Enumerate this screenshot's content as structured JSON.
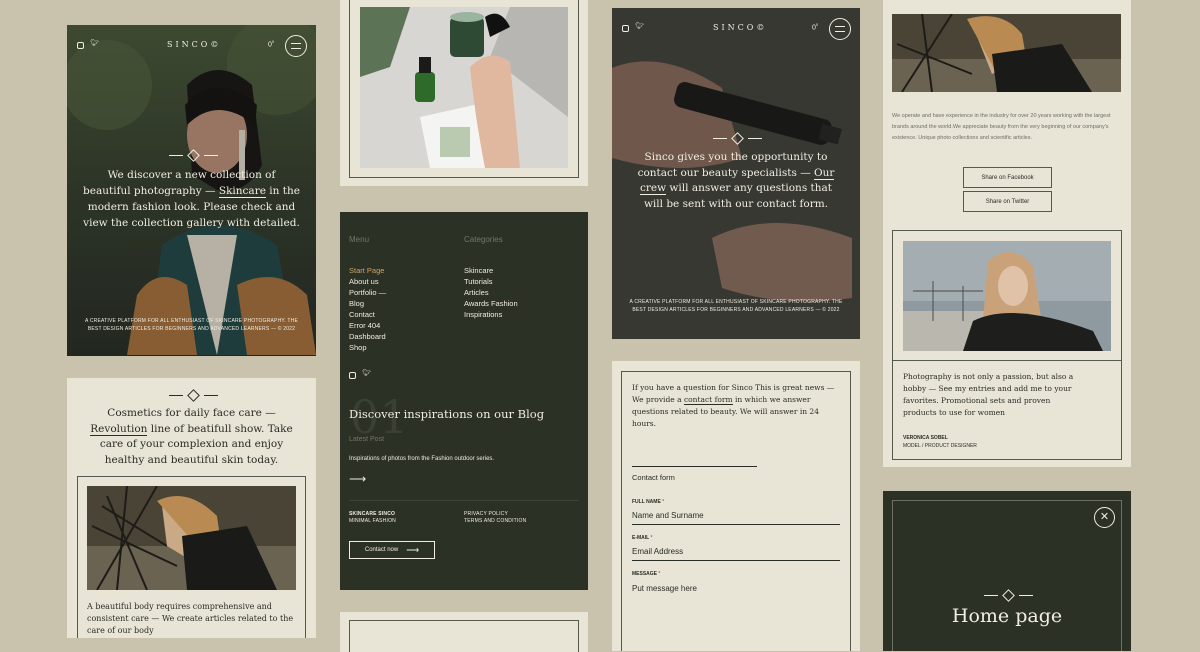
{
  "brand": "SINCO©",
  "hero_phone": {
    "counter": "0",
    "counter_sup": "0",
    "text_a": "We discover a new collection of beautiful photography — ",
    "text_link": "Skincare",
    "text_b": " in the modern fashion look. Please check and view the collection gallery with detailed.",
    "footer": "A CREATIVE PLATFORM FOR ALL ENTHUSIAST OF SKINCARE PHOTOGRAPHY. THE BEST DESIGN ARTICLES FOR BEGINNERS AND ADVANCED LEARNERS — © 2022"
  },
  "cosmetics": {
    "text_a": "Cosmetics for daily face care — ",
    "text_link": "Revolution",
    "text_b": " line of beatifull show. Take care of your complexion and enjoy healthy and beautiful skin today.",
    "body": "A beautiful body requires comprehensive and consistent care — We create articles related to the care of our body"
  },
  "menu": {
    "menu_title": "Menu",
    "categories_title": "Categories",
    "items": [
      "Start Page",
      "About us",
      "Portfolio —",
      "Blog",
      "Contact",
      "Error 404",
      "Dashboard",
      "Shop"
    ],
    "categories": [
      "Skincare",
      "Tutorials",
      "Articles",
      "Awards Fashion",
      "Inspirations"
    ],
    "blog_title": "Discover inspirations on our Blog",
    "big_number": "01",
    "latest_label": "Latest Post",
    "latest_text": "Inspirations of photos from the Fashion outdoor series.",
    "footer_left": [
      "SKINCARE SINCO",
      "MINIMAL FASHION"
    ],
    "footer_right": [
      "PRIVACY POLICY",
      "TERMS AND CONDITION"
    ],
    "contact_button": "Contact now",
    "accent": "#c9a66b"
  },
  "specialists_phone": {
    "counter": "0",
    "counter_sup": "0",
    "text_a": "Sinco gives you the opportunity to contact our beauty specialists — ",
    "text_link": "Our crew",
    "text_b": " will answer any questions that will be sent with our contact form.",
    "footer": "A CREATIVE PLATFORM FOR ALL ENTHUSIAST OF SKINCARE PHOTOGRAPHY. THE BEST DESIGN ARTICLES FOR BEGINNERS AND ADVANCED LEARNERS — © 2022"
  },
  "contact": {
    "intro_a": "If you have a question for Sinco This is great news — We provide a ",
    "intro_link": "contact form",
    "intro_b": " in which we answer questions related to beauty. We will answer in 24 hours.",
    "form_title": "Contact form",
    "name_label": "FULL NAME",
    "name_value": "Name and Surname",
    "email_label": "E-MAIL",
    "email_value": "Email Address",
    "message_label": "MESSAGE",
    "message_value": "Put message here",
    "required_mark": "*"
  },
  "about": {
    "text": "We operate and have experience in the industry for over 20 years working with the largest brands around the world.We appreciate beauty from the very beginning of our company's existence. Unique photo collections and scientific articles.",
    "facebook": "Share on Facebook",
    "twitter": "Share on Twitter",
    "quote": "Photography is not only a passion, but also a hobby — See my entries and add me to your favorites. Promotional sets and proven products to use for women",
    "author": "VERONICA SOBEL",
    "author_role": "MODEL / PRODUCT DESIGNER"
  },
  "menu_overlay": {
    "title": "Home page"
  }
}
